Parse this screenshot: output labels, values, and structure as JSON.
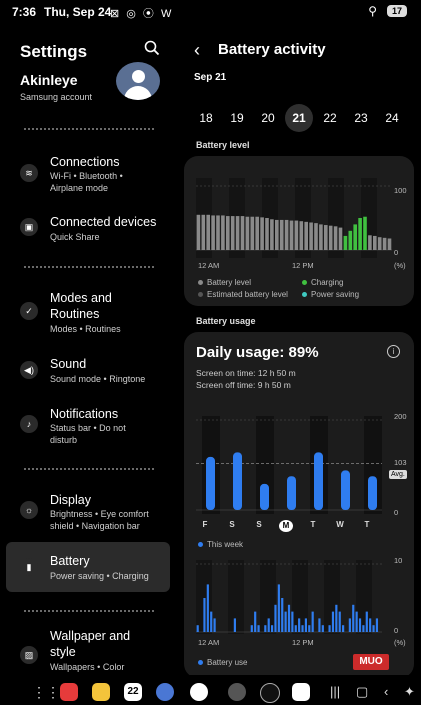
{
  "status_bar": {
    "time": "7:36",
    "date": "Thu, Sep 24",
    "notif_icons": "⊠ ◎ ⦿ W",
    "wifi": "⚲",
    "battery": "17"
  },
  "settings": {
    "title": "Settings",
    "profile": {
      "name": "Akinleye",
      "sub": "Samsung account"
    },
    "items": [
      {
        "label": "Connections",
        "sub": "Wi-Fi • Bluetooth • Airplane mode",
        "icon": "wifi-icon"
      },
      {
        "label": "Connected devices",
        "sub": "Quick Share",
        "icon": "devices-icon"
      },
      {
        "label": "Modes and Routines",
        "sub": "Modes • Routines",
        "icon": "check-circle-icon"
      },
      {
        "label": "Sound",
        "sub": "Sound mode • Ringtone",
        "icon": "speaker-icon"
      },
      {
        "label": "Notifications",
        "sub": "Status bar • Do not disturb",
        "icon": "bell-icon"
      },
      {
        "label": "Display",
        "sub": "Brightness • Eye comfort shield • Navigation bar",
        "icon": "sun-icon"
      },
      {
        "label": "Battery",
        "sub": "Power saving • Charging",
        "icon": "battery-icon"
      },
      {
        "label": "Wallpaper and style",
        "sub": "Wallpapers • Color",
        "icon": "image-icon"
      }
    ]
  },
  "battery_activity": {
    "title": "Battery activity",
    "month": "Sep 21",
    "days": [
      "18",
      "19",
      "20",
      "21",
      "22",
      "23",
      "24"
    ],
    "selected_day": "21",
    "level_section": "Battery level",
    "level_axis": {
      "top": "100",
      "bottom": "0",
      "unit": "(%)",
      "x_start": "12 AM",
      "x_mid": "12 PM"
    },
    "level_legend": [
      "Battery level",
      "Charging",
      "Estimated battery level",
      "Power saving"
    ],
    "usage_section": "Battery usage",
    "daily_usage": "Daily usage: 89%",
    "screen_on": "Screen on time: 12 h 50 m",
    "screen_off": "Screen off time: 9 h 50 m",
    "usage_axis": {
      "top": "200",
      "avg": "103",
      "bottom": "0",
      "avg_label": "Avg."
    },
    "weekdays": [
      "F",
      "S",
      "S",
      "M",
      "T",
      "W",
      "T"
    ],
    "selected_weekday_index": 3,
    "this_week": "This week",
    "hourly_axis": {
      "top": "10",
      "bottom": "0",
      "unit": "(%)",
      "x_start": "12 AM",
      "x_mid": "12 PM"
    },
    "hourly_legend": "Battery use",
    "info": "i"
  },
  "watermark": "MUO",
  "colors": {
    "accent": "#2f7df0",
    "charging": "#40c040",
    "grey_bar": "#8a8a8a"
  },
  "chart_data": [
    {
      "type": "bar",
      "title": "Battery level",
      "ylabel": "(%)",
      "ylim": [
        0,
        100
      ],
      "series": [
        {
          "name": "Battery level",
          "values": [
            55,
            55,
            55,
            54,
            54,
            54,
            53,
            53,
            53,
            53,
            52,
            52,
            52,
            51,
            50,
            48,
            47,
            47,
            47,
            46,
            46,
            45,
            44,
            43,
            42,
            40,
            39,
            38,
            37,
            35,
            33,
            31,
            29,
            27,
            25,
            23,
            22,
            20,
            19,
            18
          ]
        },
        {
          "name": "Charging",
          "values": [
            0,
            0,
            0,
            0,
            0,
            0,
            0,
            0,
            0,
            0,
            0,
            0,
            0,
            0,
            0,
            0,
            0,
            0,
            0,
            0,
            0,
            0,
            0,
            0,
            0,
            0,
            0,
            0,
            0,
            0,
            22,
            30,
            40,
            50,
            52,
            0,
            0,
            0,
            0,
            0
          ]
        }
      ]
    },
    {
      "type": "bar",
      "title": "This week",
      "categories": [
        "F",
        "S",
        "S",
        "M",
        "T",
        "W",
        "T"
      ],
      "values": [
        118,
        128,
        58,
        75,
        128,
        88,
        75
      ],
      "ylim": [
        0,
        200
      ],
      "average": 103
    },
    {
      "type": "bar",
      "title": "Battery use",
      "ylabel": "(%)",
      "ylim": [
        0,
        10
      ],
      "values": [
        1,
        0,
        5,
        7,
        3,
        2,
        0,
        0,
        0,
        0,
        0,
        2,
        0,
        0,
        0,
        0,
        1,
        3,
        1,
        0,
        1,
        2,
        1,
        4,
        7,
        5,
        3,
        4,
        3,
        1,
        2,
        1,
        2,
        1,
        3,
        0,
        2,
        1,
        0,
        1,
        3,
        4,
        3,
        1,
        0,
        2,
        4,
        3,
        2,
        1,
        3,
        2,
        1,
        2,
        0
      ]
    }
  ]
}
